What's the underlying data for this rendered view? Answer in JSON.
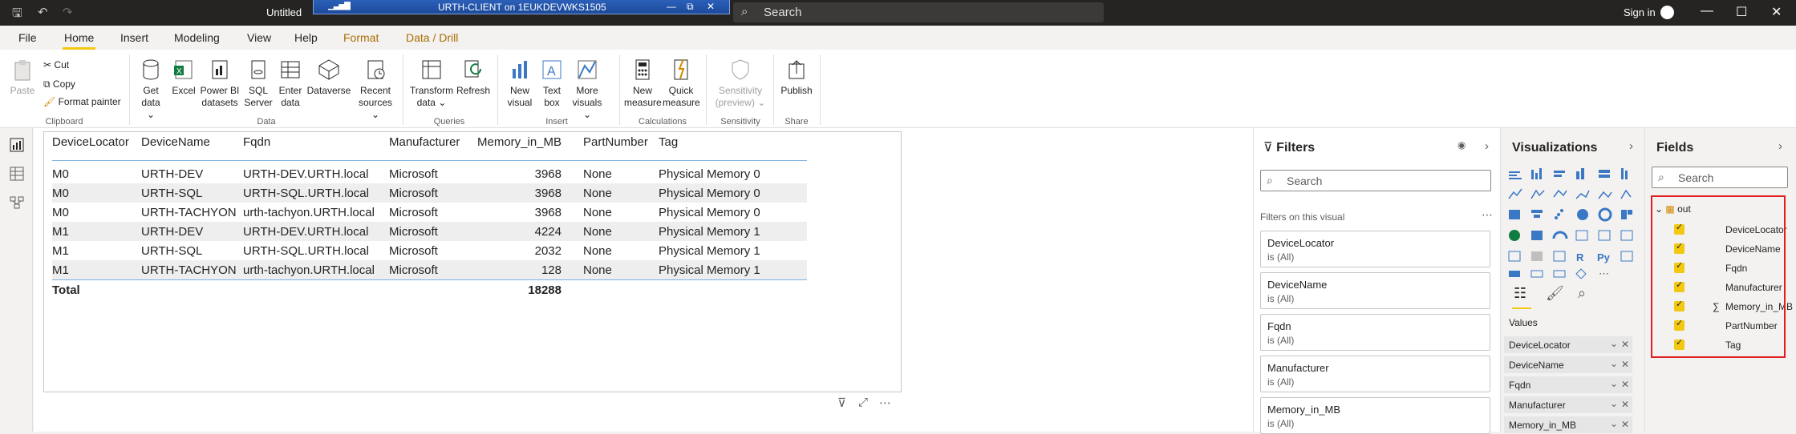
{
  "titlebar": {
    "doc_title": "Untitled",
    "rdp_title": "URTH-CLIENT on 1EUKDEVWKS1505",
    "search": "Search",
    "signin": "Sign in"
  },
  "tabs": [
    "File",
    "Home",
    "Insert",
    "Modeling",
    "View",
    "Help",
    "Format",
    "Data / Drill"
  ],
  "ribbon": {
    "clipboard": {
      "paste": "Paste",
      "cut": "Cut",
      "copy": "Copy",
      "format_painter": "Format painter",
      "group": "Clipboard"
    },
    "data": {
      "get_data": "Get data",
      "excel": "Excel",
      "powerbi": "Power BI datasets",
      "sql": "SQL Server",
      "enter": "Enter data",
      "dataverse": "Dataverse",
      "recent": "Recent sources",
      "group": "Data"
    },
    "queries": {
      "transform": "Transform data",
      "refresh": "Refresh",
      "group": "Queries"
    },
    "insert": {
      "new_visual": "New visual",
      "text_box": "Text box",
      "more_visuals": "More visuals",
      "group": "Insert"
    },
    "calculations": {
      "new_measure": "New measure",
      "quick_measure": "Quick measure",
      "group": "Calculations"
    },
    "sensitivity": {
      "label": "Sensitivity (preview)",
      "group": "Sensitivity"
    },
    "share": {
      "publish": "Publish",
      "group": "Share"
    }
  },
  "table": {
    "columns": [
      "DeviceLocator",
      "DeviceName",
      "Fqdn",
      "Manufacturer",
      "Memory_in_MB",
      "PartNumber",
      "Tag"
    ],
    "rows": [
      [
        "M0",
        "URTH-DEV",
        "URTH-DEV.URTH.local",
        "Microsoft",
        "3968",
        "None",
        "Physical Memory 0"
      ],
      [
        "M0",
        "URTH-SQL",
        "URTH-SQL.URTH.local",
        "Microsoft",
        "3968",
        "None",
        "Physical Memory 0"
      ],
      [
        "M0",
        "URTH-TACHYON",
        "urth-tachyon.URTH.local",
        "Microsoft",
        "3968",
        "None",
        "Physical Memory 0"
      ],
      [
        "M1",
        "URTH-DEV",
        "URTH-DEV.URTH.local",
        "Microsoft",
        "4224",
        "None",
        "Physical Memory 1"
      ],
      [
        "M1",
        "URTH-SQL",
        "URTH-SQL.URTH.local",
        "Microsoft",
        "2032",
        "None",
        "Physical Memory 1"
      ],
      [
        "M1",
        "URTH-TACHYON",
        "urth-tachyon.URTH.local",
        "Microsoft",
        "128",
        "None",
        "Physical Memory 1"
      ]
    ],
    "total_label": "Total",
    "total_value": "18288"
  },
  "filters": {
    "title": "Filters",
    "search": "Search",
    "section": "Filters on this visual",
    "cards": [
      {
        "name": "DeviceLocator",
        "value": "is (All)"
      },
      {
        "name": "DeviceName",
        "value": "is (All)"
      },
      {
        "name": "Fqdn",
        "value": "is (All)"
      },
      {
        "name": "Manufacturer",
        "value": "is (All)"
      },
      {
        "name": "Memory_in_MB",
        "value": "is (All)"
      }
    ]
  },
  "visualizations": {
    "title": "Visualizations",
    "values_label": "Values",
    "wells": [
      "DeviceLocator",
      "DeviceName",
      "Fqdn",
      "Manufacturer",
      "Memory_in_MB"
    ]
  },
  "fields": {
    "title": "Fields",
    "search": "Search",
    "table": "out",
    "items": [
      "DeviceLocator",
      "DeviceName",
      "Fqdn",
      "Manufacturer",
      "Memory_in_MB",
      "PartNumber",
      "Tag"
    ],
    "sum_symbol": "∑"
  },
  "colors": {
    "accent": "#f2c811",
    "highlight": "#e02020",
    "titlebar": "#252423"
  }
}
